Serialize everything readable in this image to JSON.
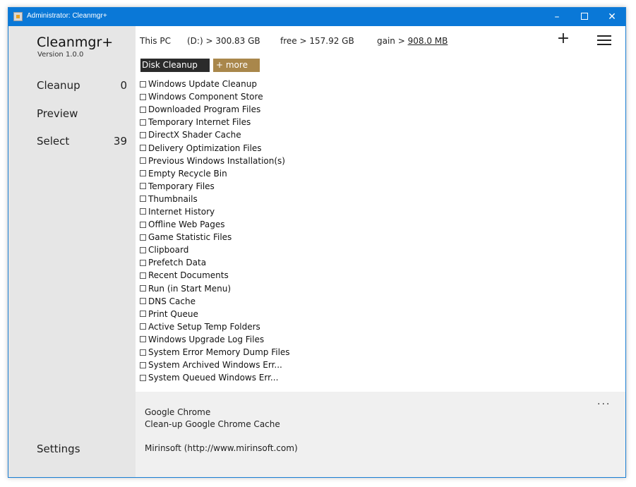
{
  "window": {
    "title": "Administrator: Cleanmgr+",
    "minimize_glyph": "–",
    "close_glyph": "✕"
  },
  "sidebar": {
    "app_name": "Cleanmgr+",
    "version": "Version 1.0.0",
    "nav": [
      {
        "label": "Cleanup",
        "count": "0"
      },
      {
        "label": "Preview",
        "count": ""
      },
      {
        "label": "Select",
        "count": "39"
      }
    ],
    "settings_label": "Settings"
  },
  "drive": {
    "pc_label": "This PC",
    "size": "(D:) > 300.83 GB",
    "free": "free >  157.92 GB",
    "gain_label": "gain > ",
    "gain_value": "908.0 MB"
  },
  "toolbar": {
    "add_glyph": "+",
    "add_icon": "plus-icon",
    "menu_icon": "hamburger-menu-icon"
  },
  "tabs": {
    "disk_cleanup": "Disk Cleanup",
    "more": "+ more"
  },
  "colors": {
    "titlebar": "#0a78d7",
    "sidebar": "#e6e6e6",
    "tab_active": "#2b2b2b",
    "tab_more": "#a9874b",
    "footer": "#f0f0f0"
  },
  "items": [
    "Windows Update Cleanup",
    "Windows Component Store",
    "Downloaded Program Files",
    "Temporary Internet Files",
    "DirectX Shader Cache",
    "Delivery Optimization Files",
    "Previous Windows Installation(s)",
    "Empty Recycle Bin",
    "Temporary Files",
    "Thumbnails",
    "Internet History",
    "Offline Web Pages",
    "Game Statistic Files",
    "Clipboard",
    "Prefetch Data",
    "Recent Documents",
    "Run (in Start Menu)",
    "DNS Cache",
    "Print Queue",
    "Active Setup Temp Folders",
    "Windows Upgrade Log Files",
    "System Error Memory Dump Files",
    "System Archived Windows Err...",
    "System Queued Windows Err..."
  ],
  "footer": {
    "more_glyph": "...",
    "line1": "Google Chrome",
    "line2": "Clean-up Google Chrome Cache",
    "line3": "Mirinsoft (http://www.mirinsoft.com)"
  }
}
